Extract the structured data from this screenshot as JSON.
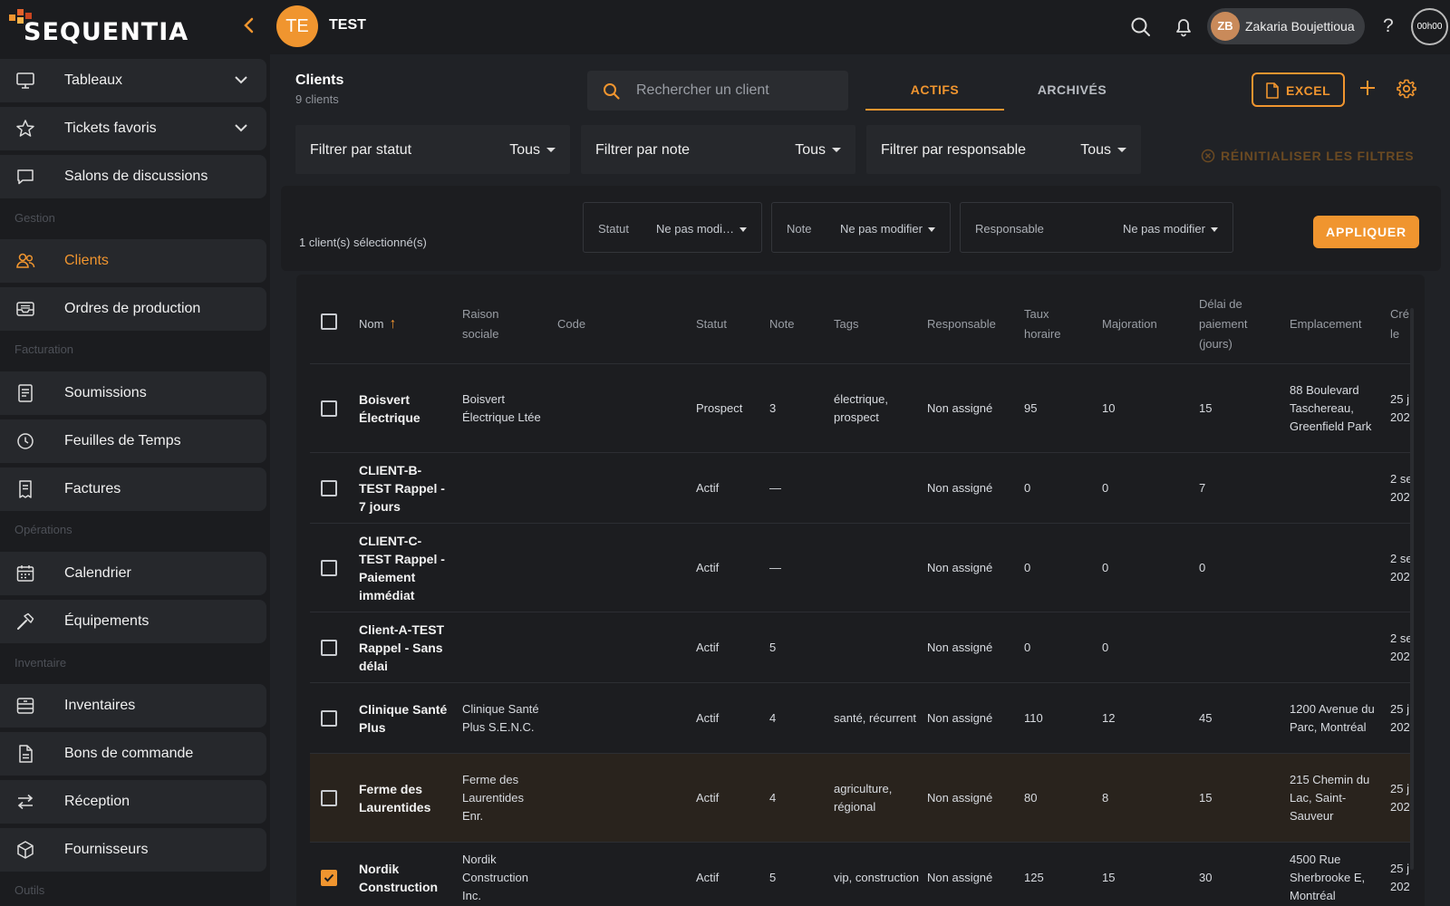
{
  "app": {
    "logo_text": "SEQUENTIA",
    "workspace_initials": "TE",
    "workspace_name": "TEST"
  },
  "user": {
    "initials": "ZB",
    "name": "Zakaria Boujettioua"
  },
  "help_label": "?",
  "timer": "00h00",
  "colors": {
    "accent": "#f0952f",
    "bg": "#202226",
    "panel": "#1c1d20"
  },
  "sidebar": {
    "items": [
      {
        "label": "Tableaux",
        "icon": "monitor-icon",
        "expandable": true
      },
      {
        "label": "Tickets favoris",
        "icon": "star-icon",
        "expandable": true
      },
      {
        "label": "Salons de discussions",
        "icon": "chat-icon"
      },
      {
        "label": "Clients",
        "icon": "users-icon",
        "active": true
      },
      {
        "label": "Ordres de production",
        "icon": "inbox-icon"
      },
      {
        "label": "Soumissions",
        "icon": "document-icon"
      },
      {
        "label": "Feuilles de Temps",
        "icon": "clock-icon"
      },
      {
        "label": "Factures",
        "icon": "invoice-icon"
      },
      {
        "label": "Calendrier",
        "icon": "calendar-icon"
      },
      {
        "label": "Équipements",
        "icon": "hammer-icon"
      },
      {
        "label": "Inventaires",
        "icon": "stack-icon"
      },
      {
        "label": "Bons de commande",
        "icon": "file-icon"
      },
      {
        "label": "Réception",
        "icon": "arrows-icon"
      },
      {
        "label": "Fournisseurs",
        "icon": "box-icon"
      }
    ],
    "sections": [
      "Gestion",
      "Facturation",
      "Opérations",
      "Inventaire",
      "Outils"
    ]
  },
  "main": {
    "title": "Clients",
    "subtitle": "9 clients",
    "search_placeholder": "Rechercher un client",
    "tabs": [
      "ACTIFS",
      "ARCHIVÉS"
    ],
    "excel_label": "EXCEL",
    "filters": [
      {
        "label": "Filtrer par statut",
        "value": "Tous"
      },
      {
        "label": "Filtrer par note",
        "value": "Tous"
      },
      {
        "label": "Filtrer par responsable",
        "value": "Tous"
      }
    ],
    "reset_label": "RÉINITIALISER LES FILTRES"
  },
  "bulk": {
    "count_label": "1 client(s) sélectionné(s)",
    "fields": [
      {
        "label": "Statut",
        "value": "Ne pas modi…"
      },
      {
        "label": "Note",
        "value": "Ne pas modifier"
      },
      {
        "label": "Responsable",
        "value": "Ne pas modifier"
      }
    ],
    "apply_label": "APPLIQUER"
  },
  "table": {
    "sort_arrow": "↑",
    "columns": [
      "Nom",
      "Raison sociale",
      "Code",
      "Statut",
      "Note",
      "Tags",
      "Responsable",
      "Taux horaire",
      "Majoration",
      "Délai de paiement (jours)",
      "Emplacement",
      "Cré le"
    ],
    "rows": [
      {
        "nom": "Boisvert Électrique",
        "raison": "Boisvert Électrique Ltée",
        "code": "",
        "statut": "Prospect",
        "note": "3",
        "tags": "électrique, prospect",
        "responsable": "Non assigné",
        "taux": "95",
        "majoration": "10",
        "delai": "15",
        "emplacement": "88 Boulevard Taschereau, Greenfield Park",
        "cree": "25 j 202",
        "checked": false
      },
      {
        "nom": "CLIENT-B-TEST Rappel - 7 jours",
        "raison": "",
        "code": "",
        "statut": "Actif",
        "note": "—",
        "tags": "",
        "responsable": "Non assigné",
        "taux": "0",
        "majoration": "0",
        "delai": "7",
        "emplacement": "",
        "cree": "2 se 202",
        "checked": false
      },
      {
        "nom": "CLIENT-C-TEST Rappel - Paiement immédiat",
        "raison": "",
        "code": "",
        "statut": "Actif",
        "note": "—",
        "tags": "",
        "responsable": "Non assigné",
        "taux": "0",
        "majoration": "0",
        "delai": "0",
        "emplacement": "",
        "cree": "2 se 202",
        "checked": false
      },
      {
        "nom": "Client-A-TEST Rappel - Sans délai",
        "raison": "",
        "code": "",
        "statut": "Actif",
        "note": "5",
        "tags": "",
        "responsable": "Non assigné",
        "taux": "0",
        "majoration": "0",
        "delai": "",
        "emplacement": "",
        "cree": "2 se 202",
        "checked": false
      },
      {
        "nom": "Clinique Santé Plus",
        "raison": "Clinique Santé Plus S.E.N.C.",
        "code": "",
        "statut": "Actif",
        "note": "4",
        "tags": "santé, récurrent",
        "responsable": "Non assigné",
        "taux": "110",
        "majoration": "12",
        "delai": "45",
        "emplacement": "1200 Avenue du Parc, Montréal",
        "cree": "25 j 202",
        "checked": false
      },
      {
        "nom": "Ferme des Laurentides",
        "raison": "Ferme des Laurentides Enr.",
        "code": "",
        "statut": "Actif",
        "note": "4",
        "tags": "agriculture, régional",
        "responsable": "Non assigné",
        "taux": "80",
        "majoration": "8",
        "delai": "15",
        "emplacement": "215 Chemin du Lac, Saint-Sauveur",
        "cree": "25 j 202",
        "checked": false
      },
      {
        "nom": "Nordik Construction",
        "raison": "Nordik Construction Inc.",
        "code": "",
        "statut": "Actif",
        "note": "5",
        "tags": "vip, construction",
        "responsable": "Non assigné",
        "taux": "125",
        "majoration": "15",
        "delai": "30",
        "emplacement": "4500 Rue Sherbrooke E, Montréal",
        "cree": "25 j 202",
        "checked": true
      }
    ]
  }
}
